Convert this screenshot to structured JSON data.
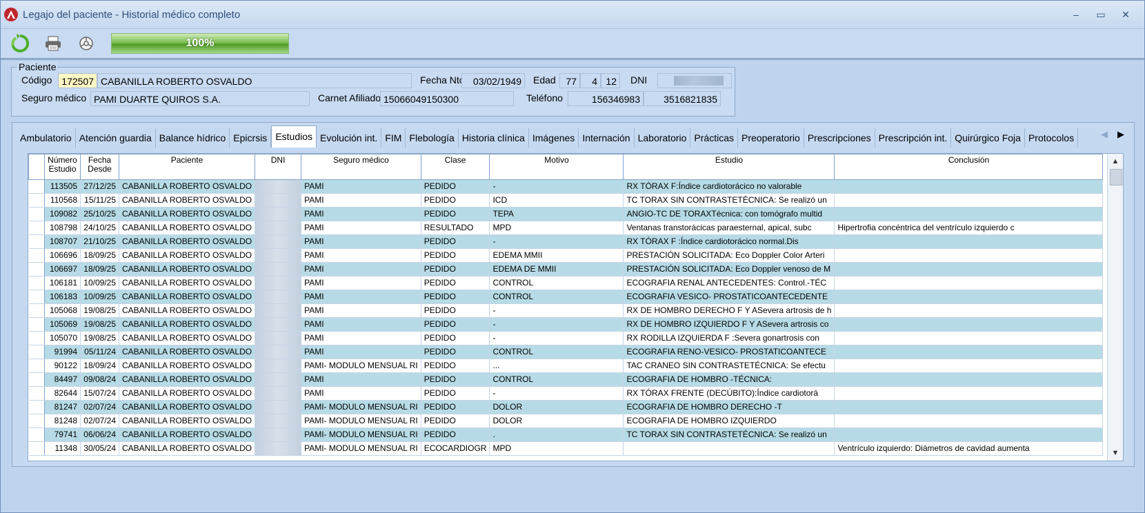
{
  "window": {
    "title": "Legajo del paciente - Historial médico completo",
    "minimize": "–",
    "maximize": "▭",
    "close": "✕"
  },
  "toolbar": {
    "progress_label": "100%",
    "progress_value": 1.0
  },
  "patient": {
    "legend": "Paciente",
    "codigo_label": "Código",
    "codigo": "172507",
    "nombre": "CABANILLA ROBERTO OSVALDO",
    "fecha_nto_label": "Fecha Nto",
    "fecha_nto": "03/02/1949",
    "edad_label": "Edad",
    "edad_anios": "77",
    "edad_meses": "4",
    "edad_dias": "12",
    "dni_label": "DNI",
    "seguro_label": "Seguro médico",
    "seguro": "PAMI DUARTE QUIROS S.A.",
    "carnet_label": "Carnet Afiliado",
    "carnet": "15066049150300",
    "telefono_label": "Teléfono",
    "telefono1": "156346983",
    "telefono2": "3516821835"
  },
  "tabs": [
    "Ambulatorio",
    "Atención guardia",
    "Balance hídrico",
    "Epicrsis",
    "Estudios",
    "Evolución int.",
    "FIM",
    "Flebología",
    "Historia clínica",
    "Imágenes",
    "Internación",
    "Laboratorio",
    "Prácticas",
    "Preoperatorio",
    "Prescripciones",
    "Prescripción int.",
    "Quirúrgico Foja",
    "Protocolos"
  ],
  "active_tab": "Estudios",
  "grid": {
    "columns": [
      "Número Estudio",
      "Fecha Desde",
      "Paciente",
      "DNI",
      "Seguro médico",
      "Clase",
      "Motivo",
      "Estudio",
      "Conclusión"
    ],
    "rows": [
      [
        "113505",
        "27/12/25",
        "CABANILLA ROBERTO OSVALDO",
        "",
        "PAMI",
        "PEDIDO",
        "-",
        "RX TÓRAX F:Índice cardiotorácico no valorable",
        ""
      ],
      [
        "110568",
        "15/11/25",
        "CABANILLA ROBERTO OSVALDO",
        "",
        "PAMI",
        "PEDIDO",
        "ICD",
        "TC TORAX SIN CONTRASTETÉCNICA: Se realizó un",
        ""
      ],
      [
        "109082",
        "25/10/25",
        "CABANILLA ROBERTO OSVALDO",
        "",
        "PAMI",
        "PEDIDO",
        "TEPA",
        "ANGIO-TC DE TORAXTécnica: con tomógrafo multid",
        ""
      ],
      [
        "108798",
        "24/10/25",
        "CABANILLA ROBERTO OSVALDO",
        "",
        "PAMI",
        "RESULTADO",
        "MPD",
        "Ventanas transtorácicas paraesternal, apical, subc",
        "Hipertrofia concéntrica del ventrículo izquierdo c"
      ],
      [
        "108707",
        "21/10/25",
        "CABANILLA ROBERTO OSVALDO",
        "",
        "PAMI",
        "PEDIDO",
        "-",
        "RX TÓRAX F :Índice cardiotorácico normal.Dis",
        ""
      ],
      [
        "106696",
        "18/09/25",
        "CABANILLA ROBERTO OSVALDO",
        "",
        "PAMI",
        "PEDIDO",
        "EDEMA MMII",
        "PRESTACIÓN SOLICITADA: Eco Doppler Color Arteri",
        ""
      ],
      [
        "106697",
        "18/09/25",
        "CABANILLA ROBERTO OSVALDO",
        "",
        "PAMI",
        "PEDIDO",
        "EDEMA DE MMII",
        "PRESTACIÓN SOLICITADA: Eco Doppler venoso de M",
        ""
      ],
      [
        "106181",
        "10/09/25",
        "CABANILLA ROBERTO OSVALDO",
        "",
        "PAMI",
        "PEDIDO",
        "CONTROL",
        "ECOGRAFIA RENAL ANTECEDENTES: Control.-TÉC",
        ""
      ],
      [
        "106183",
        "10/09/25",
        "CABANILLA ROBERTO OSVALDO",
        "",
        "PAMI",
        "PEDIDO",
        "CONTROL",
        "ECOGRAFIA VESICO- PROSTATICOANTECEDENTE",
        ""
      ],
      [
        "105068",
        "19/08/25",
        "CABANILLA ROBERTO OSVALDO",
        "",
        "PAMI",
        "PEDIDO",
        "-",
        "RX DE HOMBRO DERECHO F Y ASevera artrosis de h",
        ""
      ],
      [
        "105069",
        "19/08/25",
        "CABANILLA ROBERTO OSVALDO",
        "",
        "PAMI",
        "PEDIDO",
        "-",
        "RX DE HOMBRO IZQUIERDO F Y ASevera artrosis co",
        ""
      ],
      [
        "105070",
        "19/08/25",
        "CABANILLA ROBERTO OSVALDO",
        "",
        "PAMI",
        "PEDIDO",
        "-",
        "RX RODILLA IZQUIERDA F :Severa gonartrosis con",
        ""
      ],
      [
        "91994",
        "05/11/24",
        "CABANILLA ROBERTO OSVALDO",
        "",
        "PAMI",
        "PEDIDO",
        "CONTROL",
        "ECOGRAFIA RENO-VESICO- PROSTATICOANTECE",
        ""
      ],
      [
        "90122",
        "18/09/24",
        "CABANILLA ROBERTO OSVALDO",
        "",
        "PAMI- MODULO MENSUAL RI",
        "PEDIDO",
        "...",
        "TAC CRANEO SIN CONTRASTETÉCNICA: Se efectu",
        ""
      ],
      [
        "84497",
        "09/08/24",
        "CABANILLA ROBERTO OSVALDO",
        "",
        "PAMI",
        "PEDIDO",
        "CONTROL",
        "ECOGRAFIA DE HOMBRO           -TÉCNICA:",
        ""
      ],
      [
        "82644",
        "15/07/24",
        "CABANILLA ROBERTO OSVALDO",
        "",
        "PAMI",
        "PEDIDO",
        "-",
        "RX TÓRAX FRENTE (DECÚBITO):Índice cardiotorá",
        ""
      ],
      [
        "81247",
        "02/07/24",
        "CABANILLA ROBERTO OSVALDO",
        "",
        "PAMI- MODULO MENSUAL RI",
        "PEDIDO",
        "DOLOR",
        "ECOGRAFIA DE HOMBRO DERECHO           -T",
        ""
      ],
      [
        "81248",
        "02/07/24",
        "CABANILLA ROBERTO OSVALDO",
        "",
        "PAMI- MODULO MENSUAL RI",
        "PEDIDO",
        "DOLOR",
        "ECOGRAFIA DE HOMBRO IZQUIERDO",
        ""
      ],
      [
        "79741",
        "06/06/24",
        "CABANILLA ROBERTO OSVALDO",
        "",
        "PAMI- MODULO MENSUAL RI",
        "PEDIDO",
        ".",
        "TC TORAX SIN CONTRASTETÉCNICA: Se realizó un",
        ""
      ],
      [
        "11348",
        "30/05/24",
        "CABANILLA ROBERTO OSVALDO",
        "",
        "PAMI- MODULO MENSUAL RI",
        "ECOCARDIOGR",
        "MPD",
        "",
        "Ventrículo izquierdo: Diámetros de cavidad aumenta"
      ]
    ]
  },
  "colors": {
    "row_alt": "#b7dbe6",
    "accent": "#c5d9f1",
    "progress": "#4f9a25"
  }
}
